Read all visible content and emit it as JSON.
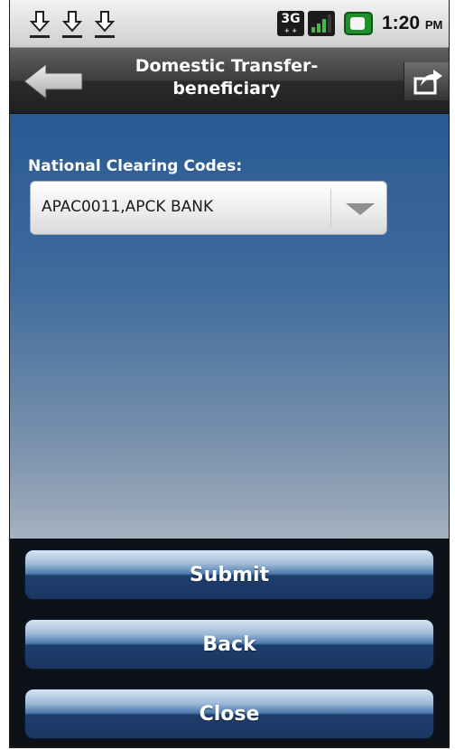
{
  "status_bar": {
    "time": "1:20",
    "time_suffix": "PM",
    "network": "3G",
    "network_sub": "+ +"
  },
  "title_bar": {
    "title_line1": "Domestic Transfer-",
    "title_line2": "beneficiary"
  },
  "form": {
    "national_clearing_codes_label": "National Clearing Codes:",
    "national_clearing_codes_value": "APAC0011,APCK BANK"
  },
  "actions": {
    "submit_label": "Submit",
    "back_label": "Back",
    "close_label": "Close"
  },
  "colors": {
    "accent": "#2a5a94",
    "button_top": "#d7e4f3",
    "button_bottom": "#1a3663",
    "title_bar": "#2a2b2c",
    "battery": "#1e8f2a"
  }
}
